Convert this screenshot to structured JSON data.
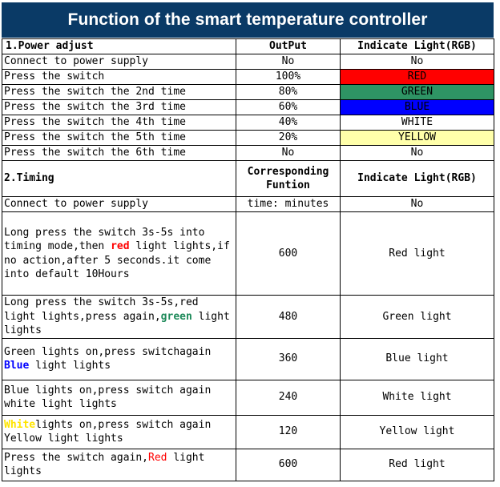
{
  "title": "Function of the smart temperature controller",
  "section1": {
    "header": {
      "label": "1.Power adjust",
      "col2": "OutPut",
      "col3": "Indicate Light(RGB)"
    },
    "rows": [
      {
        "action": "Connect to power supply",
        "output": "No",
        "indicator": "No",
        "indicator_bg": "#FFFFFF"
      },
      {
        "action": "Press the switch",
        "output": "100%",
        "indicator": "RED",
        "indicator_bg": "#FF0000"
      },
      {
        "action": "Press the switch the 2nd time",
        "output": "80%",
        "indicator": "GREEN",
        "indicator_bg": "#2E9464"
      },
      {
        "action": "Press the switch the 3rd time",
        "output": "60%",
        "indicator": "BLUE",
        "indicator_bg": "#0000FF"
      },
      {
        "action": "Press the switch the 4th time",
        "output": "40%",
        "indicator": "WHITE",
        "indicator_bg": "#FFFFFF"
      },
      {
        "action": "Press the switch the 5th time",
        "output": "20%",
        "indicator": "YELLOW",
        "indicator_bg": "#FFFFAA"
      },
      {
        "action": "Press the switch the 6th time",
        "output": "No",
        "indicator": "No",
        "indicator_bg": "#FFFFFF"
      }
    ]
  },
  "section2": {
    "header": {
      "label": "2.Timing",
      "col2_line1": "Corresponding",
      "col2_line2": "Funtion",
      "col3": "Indicate Light(RGB)"
    },
    "rows": [
      {
        "action_parts": [
          {
            "t": "Connect to power supply",
            "c": "plain"
          }
        ],
        "minutes": "time: minutes",
        "indicator": "No"
      },
      {
        "action_parts": [
          {
            "t": "Long press the switch 3s-5s into timing mode,then ",
            "c": "plain"
          },
          {
            "t": "red",
            "c": "red"
          },
          {
            "t": " light lights,if no action,after 5 seconds.it come into default 10Hours",
            "c": "plain"
          }
        ],
        "minutes": "600",
        "indicator": "Red light"
      },
      {
        "action_parts": [
          {
            "t": "Long press the switch 3s-5s,red light lights,press again,",
            "c": "plain"
          },
          {
            "t": "green",
            "c": "green"
          },
          {
            "t": " light lights",
            "c": "plain"
          }
        ],
        "minutes": "480",
        "indicator": "Green light"
      },
      {
        "action_parts": [
          {
            "t": "Green lights on,press switchagain ",
            "c": "plain"
          },
          {
            "t": "Blue",
            "c": "blue"
          },
          {
            "t": " light lights",
            "c": "plain"
          }
        ],
        "minutes": "360",
        "indicator": "Blue light"
      },
      {
        "action_parts": [
          {
            "t": "Blue lights on,press switch again white light lights",
            "c": "plain"
          }
        ],
        "minutes": "240",
        "indicator": "White light"
      },
      {
        "action_parts": [
          {
            "t": "White",
            "c": "yellow"
          },
          {
            "t": "lights on,press switch again Yellow light lights",
            "c": "plain"
          }
        ],
        "minutes": "120",
        "indicator": "Yellow light"
      },
      {
        "action_parts": [
          {
            "t": "Press the switch again,",
            "c": "plain"
          },
          {
            "t": "Red",
            "c": "red-plain"
          },
          {
            "t": " light lights",
            "c": "plain"
          }
        ],
        "minutes": "600",
        "indicator": "Red light"
      }
    ]
  },
  "colors": {
    "title_bg": "#0A3A66",
    "header_text": "#FF0000",
    "red": "#FF0000",
    "green": "#2E9464",
    "blue": "#0000FF",
    "yellow": "#FFFFAA",
    "grid_line": "#000000"
  }
}
